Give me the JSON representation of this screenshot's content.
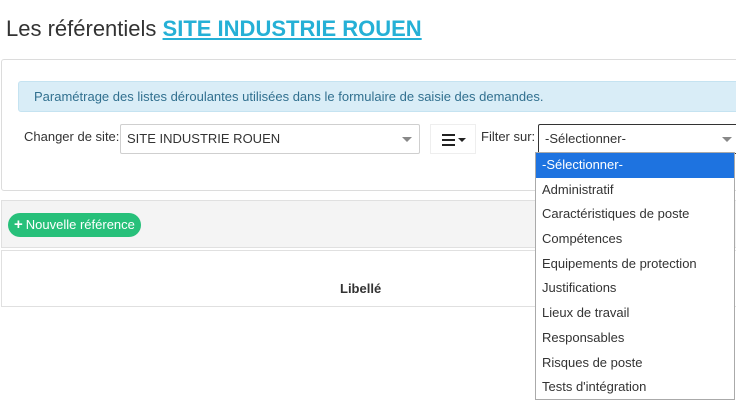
{
  "header": {
    "title_prefix": "Les référentiels",
    "site_name": "SITE INDUSTRIE ROUEN"
  },
  "info": {
    "message": "Paramétrage des listes déroulantes utilisées dans le formulaire de saisie des demandes."
  },
  "filters": {
    "site_label": "Changer de site:",
    "site_value": "SITE INDUSTRIE ROUEN",
    "filter_label": "Filter sur:",
    "filter_value": "-Sélectionner-"
  },
  "dropdown": {
    "options": [
      "-Sélectionner-",
      "Administratif",
      "Caractéristiques de poste",
      "Compétences",
      "Equipements de protection",
      "Justifications",
      "Lieux de travail",
      "Responsables",
      "Risques de poste",
      "Tests d'intégration"
    ],
    "selected_index": 0
  },
  "toolbar": {
    "new_button_label": "Nouvelle référence"
  },
  "table": {
    "columns": [
      "Libellé"
    ]
  },
  "colors": {
    "title_link": "#25b0d6",
    "info_bg": "#d9edf7",
    "info_text": "#31708f",
    "selected_option": "#1e73e0",
    "new_button": "#27c07a"
  },
  "icons": {
    "menu": "list-menu-icon",
    "plus": "plus-icon"
  }
}
